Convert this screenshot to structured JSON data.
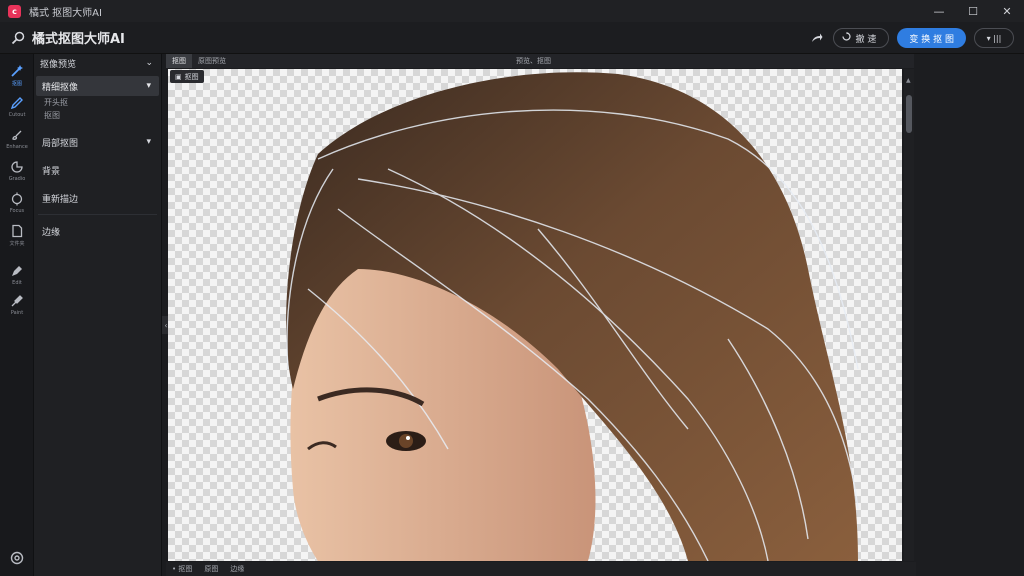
{
  "window": {
    "title": "橘式 抠图大师AI",
    "controls": [
      "—",
      "☐",
      "✕"
    ]
  },
  "toolbar": {
    "brand": "橘式抠图大师AI",
    "outline_button": "撤 速",
    "primary_button": "变 换 抠 图",
    "dropdown_label": "▾  |||"
  },
  "rail": {
    "items": [
      {
        "label": "抠图",
        "icon": "magic-wand-icon",
        "active": true
      },
      {
        "label": "Cutout",
        "icon": "pen-icon",
        "active": false
      },
      {
        "label": "Enhance",
        "icon": "brush-icon",
        "active": false
      },
      {
        "label": "Gradio",
        "icon": "gradient-icon",
        "active": false
      },
      {
        "label": "Focus",
        "icon": "target-icon",
        "active": false
      },
      {
        "label": "文件夹",
        "icon": "document-icon",
        "active": false
      },
      {
        "label": "Edit",
        "icon": "edit-icon",
        "active": false
      },
      {
        "label": "Paint",
        "icon": "paint-icon",
        "active": false
      }
    ],
    "bottom_icon": "settings-icon"
  },
  "panel": {
    "header": "抠像预览",
    "dropdown_1": "精细抠像",
    "sub_1": "开头抠",
    "sub_2": "抠图",
    "dropdown_2": "局部抠图",
    "row_1": "背景",
    "row_2": "重新描边",
    "row_3": "边缘"
  },
  "canvas": {
    "tabs": [
      "抠图",
      "原图预览"
    ],
    "center_label": "预览、抠图",
    "badge": "抠图"
  },
  "statusbar": {
    "items": [
      "• 抠图",
      "原图",
      "边缘"
    ]
  }
}
